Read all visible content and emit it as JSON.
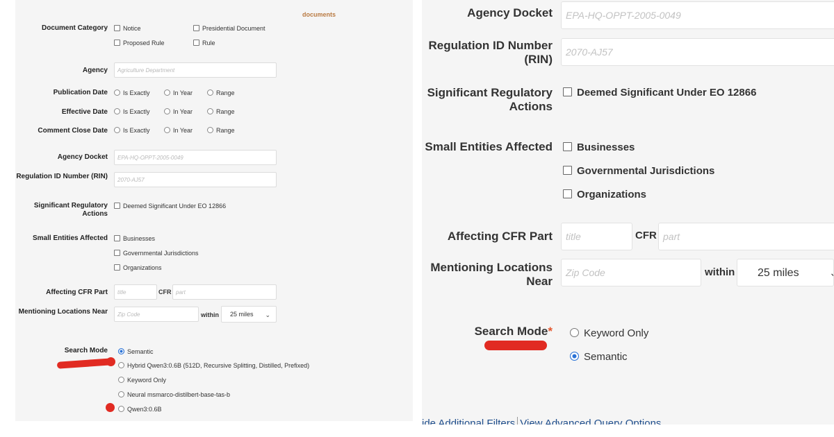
{
  "left": {
    "documents_link": "documents",
    "document_category": {
      "label": "Document Category",
      "options": [
        "Notice",
        "Presidential Document",
        "Proposed Rule",
        "Rule"
      ]
    },
    "agency": {
      "label": "Agency",
      "placeholder": "Agriculture Department"
    },
    "date_filters": [
      {
        "label": "Publication Date",
        "options": [
          "Is Exactly",
          "In Year",
          "Range"
        ]
      },
      {
        "label": "Effective Date",
        "options": [
          "Is Exactly",
          "In Year",
          "Range"
        ]
      },
      {
        "label": "Comment Close Date",
        "options": [
          "Is Exactly",
          "In Year",
          "Range"
        ]
      }
    ],
    "agency_docket": {
      "label": "Agency Docket",
      "placeholder": "EPA-HQ-OPPT-2005-0049"
    },
    "rin": {
      "label": "Regulation ID Number (RIN)",
      "placeholder": "2070-AJ57"
    },
    "significant": {
      "label": "Significant Regulatory Actions",
      "option": "Deemed Significant Under EO 12866"
    },
    "small_entities": {
      "label": "Small Entities Affected",
      "options": [
        "Businesses",
        "Governmental Jurisdictions",
        "Organizations"
      ]
    },
    "cfr": {
      "label": "Affecting CFR Part",
      "title_placeholder": "title",
      "middle": "CFR",
      "part_placeholder": "part"
    },
    "locations": {
      "label": "Mentioning Locations Near",
      "zip_placeholder": "Zip Code",
      "within": "within",
      "distance": "25 miles"
    },
    "search_mode": {
      "label": "Search Mode",
      "options": [
        "Semantic",
        "Hybrid Qwen3:0.6B (512D, Recursive Splitting, Distilled, Prefixed)",
        "Keyword Only",
        "Neural msmarco-distilbert-base-tas-b",
        "Qwen3:0.6B"
      ],
      "selected": "Semantic"
    }
  },
  "right": {
    "agency_docket": {
      "label": "Agency Docket",
      "placeholder": "EPA-HQ-OPPT-2005-0049"
    },
    "rin": {
      "label": "Regulation ID Number (RIN)",
      "placeholder": "2070-AJ57"
    },
    "significant": {
      "label": "Significant Regulatory Actions",
      "option": "Deemed Significant Under EO 12866"
    },
    "small_entities": {
      "label": "Small Entities Affected",
      "options": [
        "Businesses",
        "Governmental Jurisdictions",
        "Organizations"
      ]
    },
    "cfr": {
      "label": "Affecting CFR Part",
      "title_placeholder": "title",
      "middle": "CFR",
      "part_placeholder": "part"
    },
    "locations": {
      "label": "Mentioning Locations Near",
      "zip_placeholder": "Zip Code",
      "within": "within",
      "distance": "25 miles"
    },
    "search_mode": {
      "label": "Search Mode",
      "required_mark": "*",
      "options": [
        "Keyword Only",
        "Semantic"
      ],
      "selected": "Semantic"
    },
    "links": {
      "hide_filters": "ide Additional Filters",
      "advanced_query": "View Advanced Query Options"
    }
  },
  "colors": {
    "accent_blue": "#2a72d6",
    "annotation_red": "#e12b22",
    "link_brown": "#b97a42",
    "required_orange": "#e4572e"
  }
}
